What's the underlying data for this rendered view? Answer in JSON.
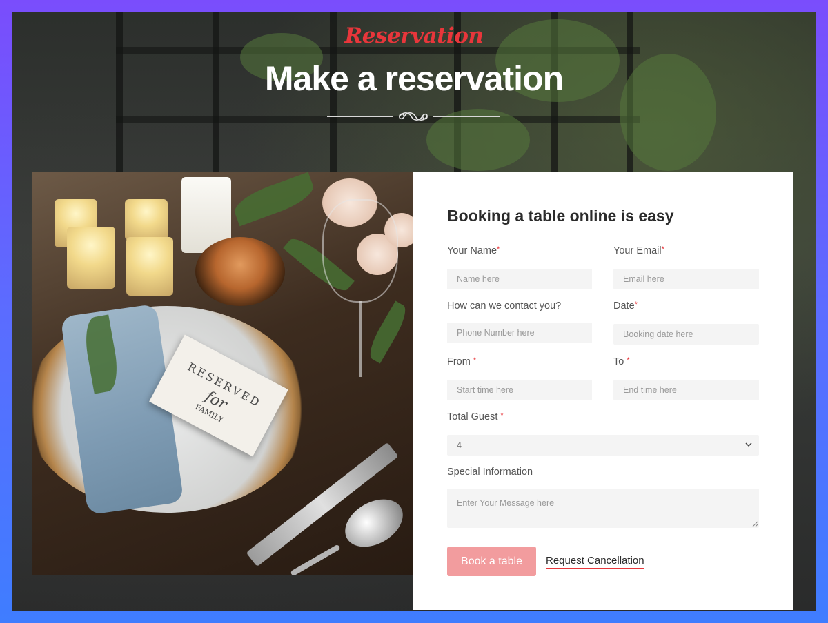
{
  "header": {
    "script_title": "Reservation",
    "main_title": "Make a reservation"
  },
  "image": {
    "card_line1": "RESERVED",
    "card_line2": "for",
    "card_line3": "FAMILY"
  },
  "form": {
    "title": "Booking a table online is easy",
    "name": {
      "label": "Your Name",
      "required": "*",
      "placeholder": "Name here"
    },
    "email": {
      "label": "Your Email",
      "required": "*",
      "placeholder": "Email here"
    },
    "contact": {
      "label": "How can we contact you?",
      "placeholder": "Phone Number here"
    },
    "date": {
      "label": "Date",
      "required": "*",
      "placeholder": "Booking date here"
    },
    "from": {
      "label": "From ",
      "required": "*",
      "placeholder": "Start time here"
    },
    "to": {
      "label": "To ",
      "required": "*",
      "placeholder": "End time here"
    },
    "guests": {
      "label": "Total Guest ",
      "required": "*",
      "value": "4"
    },
    "special": {
      "label": "Special Information",
      "placeholder": "Enter Your Message here"
    },
    "book_button": "Book a table",
    "cancel_link": "Request Cancellation"
  },
  "colors": {
    "accent_red": "#e8363b",
    "button_pink": "#f29c9e",
    "frame_gradient_top": "#7a4dfc",
    "frame_gradient_bottom": "#3f7dff"
  },
  "icons": {
    "divider": "ornament-swirl-icon",
    "select": "chevron-down-icon"
  }
}
